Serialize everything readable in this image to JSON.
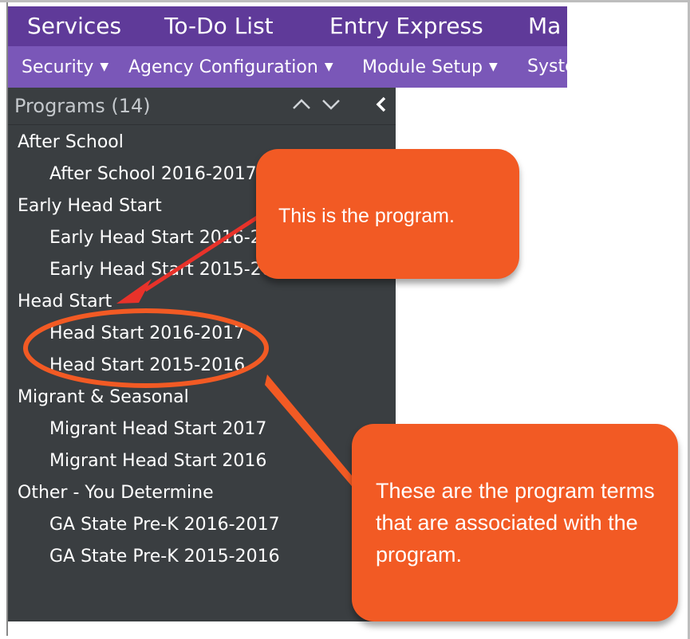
{
  "topbar": {
    "tabs": [
      "Services",
      "To-Do List",
      "Entry Express",
      "Ma"
    ]
  },
  "subbar": {
    "menus": [
      "Security",
      "Agency Configuration",
      "Module Setup",
      "Syste"
    ]
  },
  "panel": {
    "title": "Programs (14)",
    "icons": [
      "chevron-up-icon",
      "chevron-down-icon",
      "collapse-left-icon"
    ],
    "groups": [
      {
        "label": "After School",
        "terms": [
          "After School 2016-2017"
        ]
      },
      {
        "label": "Early Head Start",
        "terms": [
          "Early Head Start 2016-2017",
          "Early Head Start 2015-2016"
        ]
      },
      {
        "label": "Head Start",
        "terms": [
          "Head Start 2016-2017",
          "Head Start 2015-2016"
        ]
      },
      {
        "label": "Migrant & Seasonal",
        "terms": [
          "Migrant Head Start 2017",
          "Migrant Head Start 2016"
        ]
      },
      {
        "label": "Other - You Determine",
        "terms": [
          "GA State Pre-K 2016-2017",
          "GA State Pre-K 2015-2016"
        ]
      }
    ]
  },
  "callouts": {
    "program": "This is the program.",
    "terms": "These are the program terms that are  associated with the program."
  },
  "colors": {
    "topbar": "#5f3a99",
    "subbar": "#7a57b8",
    "panel": "#3a3e41",
    "callout": "#f25a24"
  }
}
